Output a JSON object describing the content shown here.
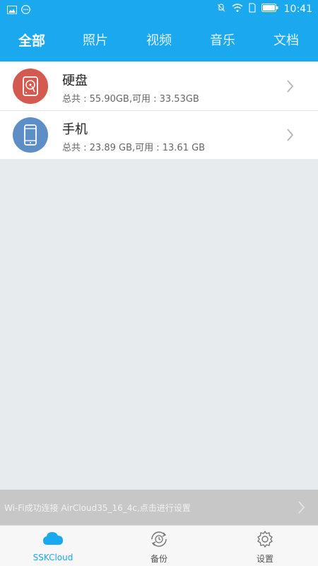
{
  "status_bar": {
    "time": "10:41",
    "icons": [
      "image-icon",
      "dots-icon",
      "mute-icon",
      "wifi-icon",
      "sim-icon",
      "battery-icon"
    ]
  },
  "tabs": [
    {
      "label": "全部",
      "active": true
    },
    {
      "label": "照片",
      "active": false
    },
    {
      "label": "视频",
      "active": false
    },
    {
      "label": "音乐",
      "active": false
    },
    {
      "label": "文档",
      "active": false
    }
  ],
  "storage_items": [
    {
      "title": "硬盘",
      "subtitle": "总共 : 55.90GB,可用 : 33.53GB",
      "icon": "hard-disk-icon",
      "color": "#d45a4f"
    },
    {
      "title": "手机",
      "subtitle": "总共 : 23.89 GB,可用 : 13.61 GB",
      "icon": "phone-icon",
      "color": "#5d8fc6"
    }
  ],
  "wifi_banner": {
    "text": "Wi-Fi成功连接 AirCloud35_16_4c,点击进行设置"
  },
  "bottom_nav": [
    {
      "label": "SSKCloud",
      "icon": "cloud-icon",
      "active": true
    },
    {
      "label": "备份",
      "icon": "backup-icon",
      "active": false
    },
    {
      "label": "设置",
      "icon": "gear-icon",
      "active": false
    }
  ],
  "colors": {
    "accent": "#1aa8ef",
    "background": "#e7ebee",
    "banner": "#c7c7c7"
  }
}
